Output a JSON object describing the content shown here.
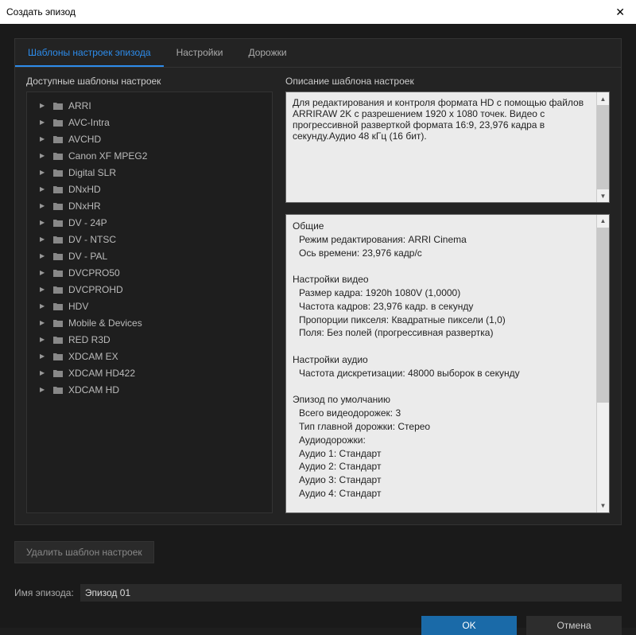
{
  "window": {
    "title": "Создать эпизод"
  },
  "tabs": [
    {
      "label": "Шаблоны настроек эпизода",
      "active": true
    },
    {
      "label": "Настройки",
      "active": false
    },
    {
      "label": "Дорожки",
      "active": false
    }
  ],
  "left": {
    "header": "Доступные шаблоны настроек",
    "items": [
      "ARRI",
      "AVC-Intra",
      "AVCHD",
      "Canon XF MPEG2",
      "Digital SLR",
      "DNxHD",
      "DNxHR",
      "DV - 24P",
      "DV - NTSC",
      "DV - PAL",
      "DVCPRO50",
      "DVCPROHD",
      "HDV",
      "Mobile & Devices",
      "RED R3D",
      "XDCAM EX",
      "XDCAM HD422",
      "XDCAM HD"
    ]
  },
  "right": {
    "header": "Описание шаблона настроек",
    "description": "Для редактирования и контроля формата HD с помощью файлов ARRIRAW 2K с разрешением 1920 x 1080 точек. Видео с прогрессивной разверткой формата 16:9, 23,976 кадра в секунду.Аудио 48 кГц (16 бит).",
    "details": {
      "section1_title": "Общие",
      "editing_mode": "Режим редактирования: ARRI Cinema",
      "timebase": "Ось времени: 23,976 кадр/с",
      "section2_title": "Настройки видео",
      "frame_size": "Размер кадра: 1920h 1080V (1,0000)",
      "frame_rate": "Частота кадров: 23,976  кадр. в секунду",
      "pixel_aspect": "Пропорции пикселя: Квадратные пиксели (1,0)",
      "fields": "Поля: Без полей (прогрессивная развертка)",
      "section3_title": "Настройки аудио",
      "sample_rate": "Частота дискретизации: 48000 выборок в секунду",
      "section4_title": "Эпизод по умолчанию",
      "video_tracks": "Всего видеодорожек: 3",
      "master_track": "Тип главной дорожки: Стерео",
      "audio_tracks_label": "Аудиодорожки:",
      "audio1": "Аудио 1: Стандарт",
      "audio2": "Аудио 2: Стандарт",
      "audio3": "Аудио 3: Стандарт",
      "audio4": "Аудио 4: Стандарт"
    }
  },
  "delete_button": "Удалить шаблон настроек",
  "name_row": {
    "label": "Имя эпизода:",
    "value": "Эпизод 01"
  },
  "buttons": {
    "ok": "OK",
    "cancel": "Отмена"
  }
}
